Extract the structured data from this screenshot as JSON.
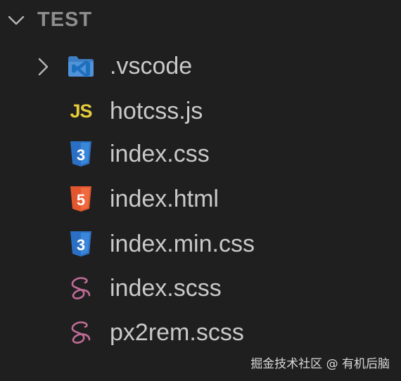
{
  "explorer": {
    "folder_name": "TEST",
    "items": [
      {
        "label": ".vscode",
        "type": "folder",
        "icon": "vscode-folder-icon"
      },
      {
        "label": "hotcss.js",
        "type": "file",
        "icon": "js-icon",
        "icon_text": "JS"
      },
      {
        "label": "index.css",
        "type": "file",
        "icon": "css3-icon",
        "icon_text": "3"
      },
      {
        "label": "index.html",
        "type": "file",
        "icon": "html5-icon",
        "icon_text": "5"
      },
      {
        "label": "index.min.css",
        "type": "file",
        "icon": "css3-icon",
        "icon_text": "3"
      },
      {
        "label": "index.scss",
        "type": "file",
        "icon": "sass-icon"
      },
      {
        "label": "px2rem.scss",
        "type": "file",
        "icon": "sass-icon"
      }
    ]
  },
  "watermark": "掘金技术社区 @ 有机后脑",
  "colors": {
    "background": "#1f1f1f",
    "header_text": "#8e8e8e",
    "label_text": "#c9c9c9",
    "js_yellow": "#e6cc3a",
    "css_blue": "#2b6fc4",
    "html_orange": "#e4572e",
    "sass_pink": "#c06c96",
    "vscode_blue": "#3b8fd9"
  }
}
